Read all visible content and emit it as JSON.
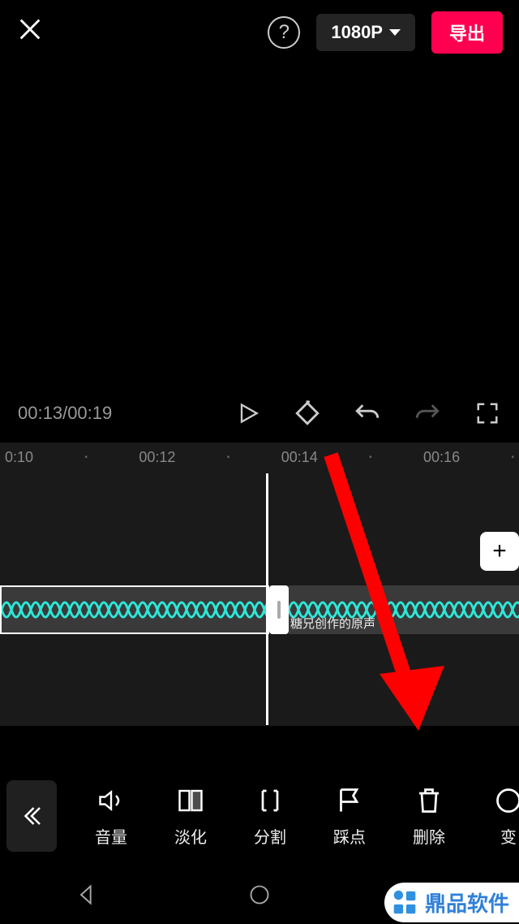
{
  "header": {
    "resolution": "1080P",
    "export": "导出"
  },
  "playback": {
    "current": "00:13",
    "total": "00:19"
  },
  "ruler": {
    "t0": "0:10",
    "t1": "00:12",
    "t2": "00:14",
    "t3": "00:16"
  },
  "clip": {
    "label": "糖兄创作的原声"
  },
  "tools": {
    "volume": "音量",
    "fade": "淡化",
    "split": "分割",
    "beat": "踩点",
    "delete": "删除",
    "transform": "变"
  },
  "watermark": {
    "text": "鼎品软件"
  }
}
